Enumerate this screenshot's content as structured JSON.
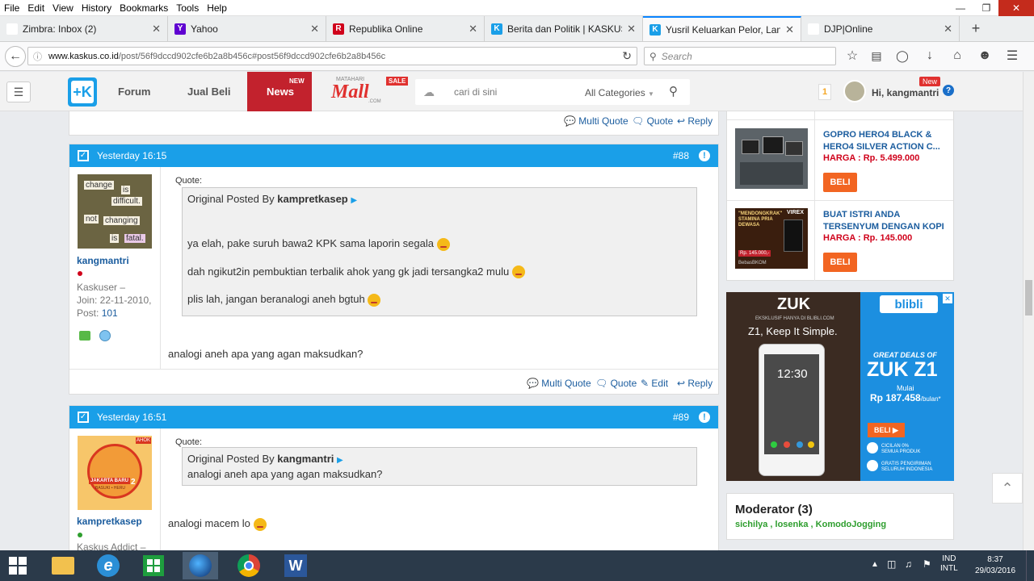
{
  "menubar": {
    "items": [
      "File",
      "Edit",
      "View",
      "History",
      "Bookmarks",
      "Tools",
      "Help"
    ]
  },
  "tabs": [
    {
      "title": "Zimbra: Inbox (2)",
      "favicon": "Z",
      "color": "#ffffff"
    },
    {
      "title": "Yahoo",
      "favicon": "Y",
      "color": "#5f01d1"
    },
    {
      "title": "Republika Online",
      "favicon": "R",
      "color": "#d0021b"
    },
    {
      "title": "Berita dan Politik | KASKUS",
      "favicon": "K",
      "color": "#1a9fe8"
    },
    {
      "title": "Yusril Keluarkan Pelor, Lan...",
      "favicon": "K",
      "color": "#1a9fe8"
    },
    {
      "title": "DJP|Online",
      "favicon": "",
      "color": "#ffffff"
    }
  ],
  "url": {
    "domain": "www.kaskus.co.id",
    "path": "/post/56f9dccd902cfe6b2a8b456c#post56f9dccd902cfe6b2a8b456c"
  },
  "browser_search": {
    "placeholder": "Search"
  },
  "kaskus": {
    "nav": {
      "forum": "Forum",
      "jualbeli": "Jual Beli",
      "news": "News",
      "news_badge": "NEW",
      "mall_top": "MATAHARI",
      "mall": "Mall",
      "mall_com": ".COM",
      "mall_badge": "SALE"
    },
    "search": {
      "placeholder": "cari di sini",
      "category": "All Categories"
    },
    "user": {
      "notif": "1",
      "greeting": "Hi, kangmantri",
      "new_badge": "New"
    }
  },
  "prev_actions": {
    "multi": "Multi Quote",
    "quote": "Quote",
    "reply": "Reply"
  },
  "posts": [
    {
      "time": "Yesterday 16:15",
      "num": "#88",
      "avatar_words": [
        "change",
        "is",
        "difficult.",
        "not",
        "changing",
        "is",
        "fatal."
      ],
      "user": "kangmantri",
      "rank": "Kaskuser –",
      "join": "Join: 22-11-2010,",
      "post_label": "Post:",
      "post_count": "101",
      "quote_label": "Quote:",
      "quote_by": "Original Posted By",
      "quote_user": "kampretkasep",
      "quote_lines": [
        "ya elah, pake suruh bawa2 KPK sama laporin segala",
        "dah ngikut2in pembuktian terbalik ahok yang gk jadi tersangka2 mulu",
        "plis lah, jangan beranalogi aneh bgtuh"
      ],
      "body": "analogi aneh apa yang agan maksudkan?",
      "actions": {
        "multi": "Multi Quote",
        "quote": "Quote",
        "edit": "Edit",
        "reply": "Reply"
      }
    },
    {
      "time": "Yesterday 16:51",
      "num": "#89",
      "avatar_words": [
        "JAKARTA BARU",
        "BASUKI • HERU",
        "2",
        "AHOK"
      ],
      "user": "kampretkasep",
      "rank": "Kaskus Addict –",
      "quote_label": "Quote:",
      "quote_by": "Original Posted By",
      "quote_user": "kangmantri",
      "quote_lines": [
        "analogi aneh apa yang agan maksudkan?"
      ],
      "body": "analogi macem lo"
    }
  ],
  "products": [
    {
      "title1": "GOPRO HERO4 BLACK &",
      "title2": "HERO4 SILVER ACTION C...",
      "price": "HARGA : Rp. 5.499.000",
      "button": "BELI"
    },
    {
      "title1": "BUAT ISTRI ANDA",
      "title2": "TERSENYUM DENGAN KOPI",
      "price": "HARGA : Rp. 145.000",
      "button": "BELI",
      "img_text": "\"MENDONGKRAK\" STAMINA PRIA DEWASA",
      "img_brand": "VIREX",
      "img_price": "Rp. 145.000,-",
      "img_tag": "BebasBKOM"
    }
  ],
  "ad": {
    "brand": "ZUK",
    "sub": "EKSKLUSIF HANYA DI BLIBLI.COM",
    "tagline": "Z1, Keep It Simple.",
    "phone_time": "12:30",
    "blibli": "blibli",
    "great": "GREAT DEALS OF",
    "model": "ZUK Z1",
    "mulai": "Mulai",
    "price": "Rp 187.458",
    "per": "/bulan*",
    "beli": "BELI",
    "promo1a": "CICILAN 0%",
    "promo1b": "SEMUA PRODUK",
    "promo2a": "GRATIS PENGIRIMAN",
    "promo2b": "SELURUH INDONESIA"
  },
  "moderator": {
    "title": "Moderator (3)",
    "names": [
      "sichilya",
      "losenka",
      "KomodoJogging"
    ],
    "sep": " , "
  },
  "taskbar": {
    "lang1": "IND",
    "lang2": "INTL",
    "time": "8:37",
    "date": "29/03/2016"
  },
  "colors": {
    "kaskus_blue": "#1a9fe8",
    "news_red": "#c2222d",
    "orange": "#f26522",
    "price_red": "#d0021b",
    "green": "#2e9e2e"
  }
}
